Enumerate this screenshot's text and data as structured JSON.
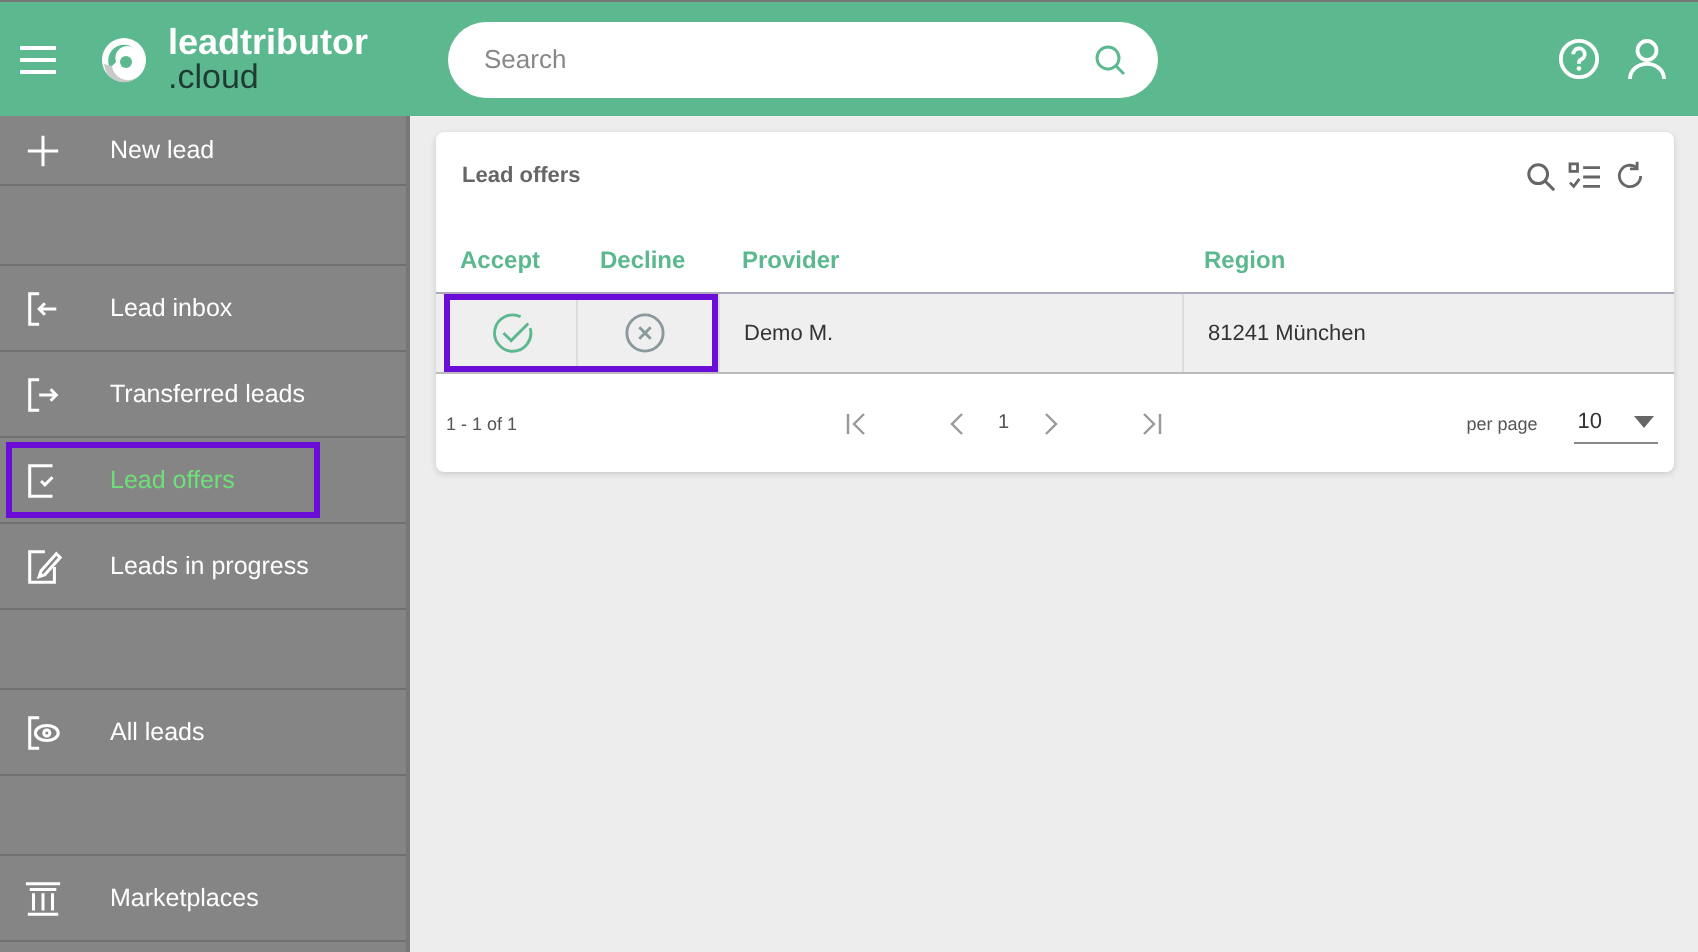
{
  "header": {
    "logo_name": "leadtributor",
    "logo_suffix": ".cloud",
    "search": {
      "placeholder": "Search"
    }
  },
  "sidebar": {
    "items": [
      {
        "kind": "item",
        "label": "New lead",
        "selected": false,
        "highlighted": false
      },
      {
        "kind": "spacer"
      },
      {
        "kind": "item",
        "label": "Lead inbox",
        "selected": false,
        "highlighted": false
      },
      {
        "kind": "item",
        "label": "Transferred leads",
        "selected": false,
        "highlighted": false
      },
      {
        "kind": "item",
        "label": "Lead offers",
        "selected": true,
        "highlighted": true
      },
      {
        "kind": "item",
        "label": "Leads in progress",
        "selected": false,
        "highlighted": false
      },
      {
        "kind": "spacer"
      },
      {
        "kind": "item",
        "label": "All leads",
        "selected": false,
        "highlighted": false
      },
      {
        "kind": "spacer"
      },
      {
        "kind": "item",
        "label": "Marketplaces",
        "selected": false,
        "highlighted": false
      }
    ]
  },
  "card": {
    "title": "Lead offers",
    "table": {
      "columns": [
        "Accept",
        "Decline",
        "Provider",
        "Region"
      ],
      "rows": [
        {
          "provider": "Demo M.",
          "region": "81241 München",
          "actions_highlighted": true
        }
      ]
    },
    "footer": {
      "range": "1 - 1 of 1",
      "page": "1",
      "per_page_label": "per page",
      "per_page": "10"
    }
  }
}
